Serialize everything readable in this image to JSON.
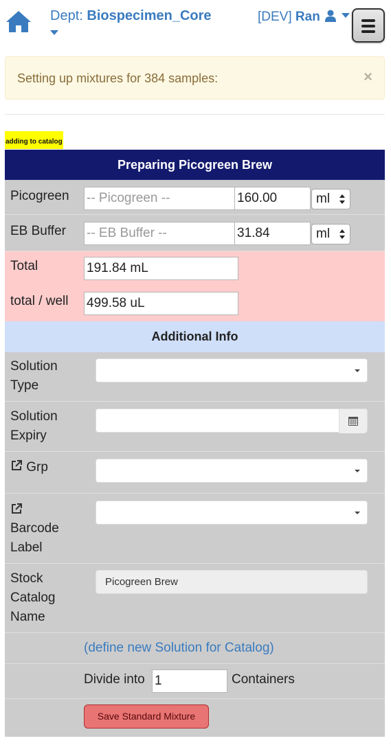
{
  "header": {
    "home_icon": "home-icon",
    "dept_label": "Dept:",
    "dept_name": "Biospecimen_Core",
    "env": "[DEV]",
    "user": "Ran",
    "user_icon": "user-icon",
    "menu_icon": "hamburger-menu-icon",
    "link_color": "#3a7bbf"
  },
  "alert": {
    "text": "Setting up mixtures for 384 samples:",
    "close": "×",
    "bg_color": "#fcf8e3"
  },
  "tag": {
    "text": "adding to catalog",
    "bg_color": "#ffff00"
  },
  "form": {
    "title": "Preparing Picogreen Brew",
    "title_bg": "#131a6e",
    "reagents": [
      {
        "label": "Picogreen",
        "placeholder": "-- Picogreen --",
        "amount": "160.00",
        "unit": "ml"
      },
      {
        "label": "EB Buffer",
        "placeholder": "-- EB Buffer --",
        "amount": "31.84",
        "unit": "ml"
      }
    ],
    "total_label": "Total",
    "total_value": "191.84 mL",
    "per_well_label": "total / well",
    "per_well_value": "499.58 uL",
    "additional_info": "Additional Info",
    "solution_type_label_1": "Solution",
    "solution_type_label_2": "Type",
    "solution_expiry_label_1": "Solution",
    "solution_expiry_label_2": "Expiry",
    "grp_label": "Grp",
    "barcode_label_1": "Barcode",
    "barcode_label_2": "Label",
    "stock_label_1": "Stock",
    "stock_label_2": "Catalog",
    "stock_label_3": "Name",
    "stock_value": "Picogreen Brew",
    "define_link": "(define new Solution for Catalog)",
    "divide_prefix": "Divide into",
    "divide_value": "1",
    "divide_suffix": "Containers",
    "save_button": "Save Standard Mixture",
    "save_color": "#e87474"
  }
}
